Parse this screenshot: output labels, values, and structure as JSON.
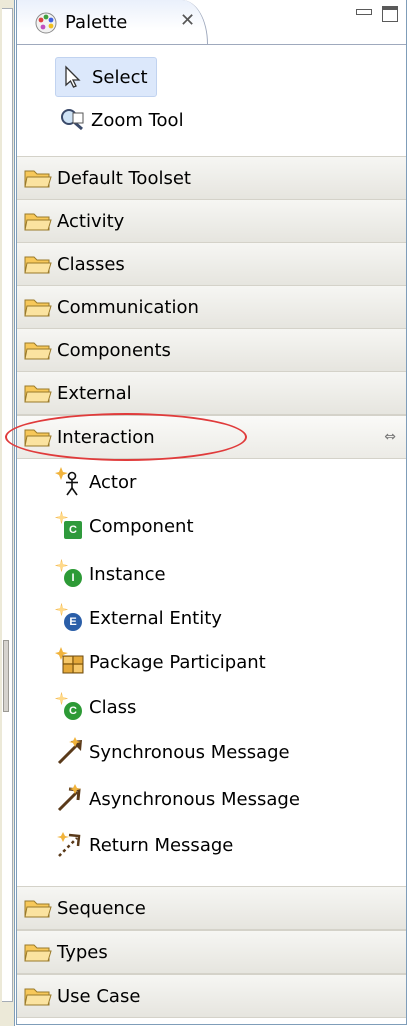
{
  "tab": {
    "title": "Palette",
    "close_glyph": "✕"
  },
  "tools": [
    {
      "label": "Select",
      "icon": "arrow-pointer-icon",
      "selected": true
    },
    {
      "label": "Zoom Tool",
      "icon": "magnifier-icon",
      "selected": false
    }
  ],
  "drawers_top": [
    {
      "label": "Default Toolset"
    },
    {
      "label": "Activity"
    },
    {
      "label": "Classes"
    },
    {
      "label": "Communication"
    },
    {
      "label": "Components"
    },
    {
      "label": "External"
    }
  ],
  "interaction": {
    "label": "Interaction",
    "pin_glyph": "⇔",
    "items": [
      {
        "label": "Actor",
        "icon": "actor-icon"
      },
      {
        "label": "Component",
        "icon": "component-icon"
      },
      {
        "label": "Instance",
        "icon": "instance-icon"
      },
      {
        "label": "External Entity",
        "icon": "external-entity-icon"
      },
      {
        "label": "Package Participant",
        "icon": "package-participant-icon"
      },
      {
        "label": "Class",
        "icon": "class-icon"
      },
      {
        "label": "Synchronous Message",
        "icon": "synchronous-message-icon"
      },
      {
        "label": "Asynchronous Message",
        "icon": "asynchronous-message-icon"
      },
      {
        "label": "Return Message",
        "icon": "return-message-icon"
      }
    ]
  },
  "drawers_bottom": [
    {
      "label": "Sequence"
    },
    {
      "label": "Types"
    },
    {
      "label": "Use Case"
    }
  ],
  "badges": {
    "component": "C",
    "instance": "I",
    "external": "E",
    "class": "C"
  },
  "colors": {
    "highlight_ring": "#e03b3b",
    "selection": "#dce8fb",
    "folder": "#f7c85a"
  }
}
